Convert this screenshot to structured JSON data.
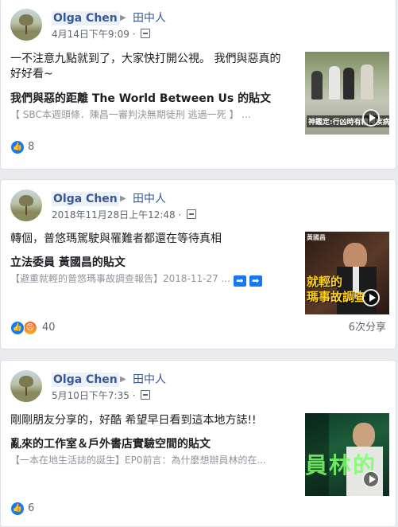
{
  "posts": [
    {
      "author": "Olga Chen",
      "target": "田中人",
      "timestamp": "4月14日下午9:09",
      "separator": "·",
      "message": "一不注意九點就到了，大家快打開公視。 我們與惡真的好好看~",
      "shared_title": "我們與惡的距離 The World Between Us 的貼文",
      "shared_excerpt": "【 SBC本週頭條．陳昌一審判決無期徒刑 逃過一死 】 ...",
      "thumb_caption": "神鑑定:行凶時有精神疾病",
      "reaction_count": "8",
      "share_count": ""
    },
    {
      "author": "Olga Chen",
      "target": "田中人",
      "timestamp": "2018年11月28日上午12:48",
      "separator": "·",
      "message": "轉個，普悠瑪駕駛與罹難者都還在等待真相",
      "shared_title": "立法委員 黃國昌的貼文",
      "shared_excerpt": "【避重就輕的普悠瑪事故調查報告】2018-11-27 ...",
      "thumb_caption_top": "黃國昌",
      "thumb_caption_1": "就輕的",
      "thumb_caption_2": "瑪事故調查",
      "reaction_count": "40",
      "share_count": "6次分享"
    },
    {
      "author": "Olga Chen",
      "target": "田中人",
      "timestamp": "5月10日下午7:35",
      "separator": "·",
      "message": "剛剛朋友分享的，好酷 希望早日看到這本地方誌!!",
      "shared_title": "亂來的工作室＆戶外書店實驗空間的貼文",
      "shared_excerpt": "【一本在地生活誌的誕生】EP0前言：為什麼想辦員林的在...",
      "thumb_caption": "員林的",
      "reaction_count": "6",
      "share_count": ""
    }
  ],
  "colors": {
    "link": "#385898",
    "like": "#1877f2",
    "muted": "#606770"
  },
  "icons": [
    "globe-privacy-icon",
    "like-icon",
    "angry-icon",
    "play-icon",
    "arrow-right-icon"
  ]
}
